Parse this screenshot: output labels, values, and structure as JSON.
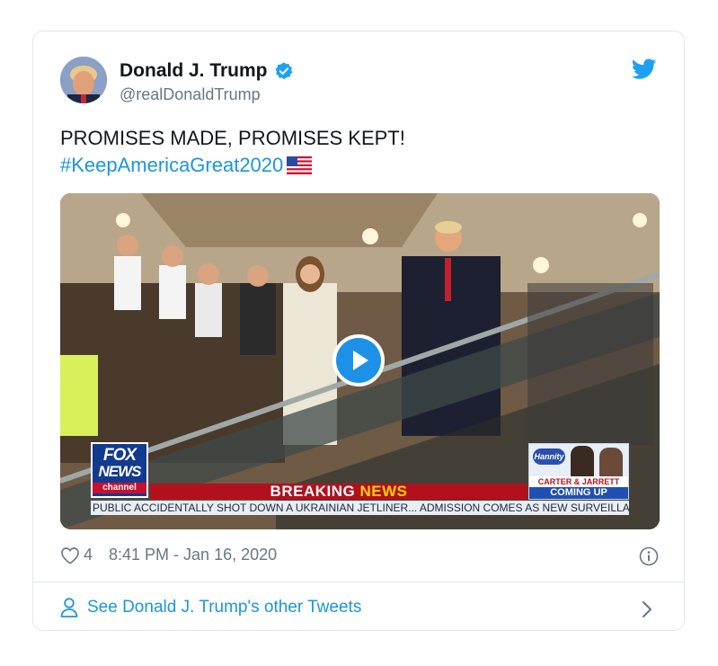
{
  "tweet": {
    "author_name": "Donald J. Trump",
    "author_handle": "@realDonaldTrump",
    "text": "PROMISES MADE, PROMISES KEPT!",
    "hashtag": "#KeepAmericaGreat2020",
    "flag_icon": "us-flag-icon",
    "likes": "4",
    "timestamp": "8:41 PM - Jan 16, 2020",
    "see_more_label": "See Donald J. Trump's other Tweets"
  },
  "video": {
    "channel_line1": "FOX",
    "channel_line2": "NEWS",
    "channel_line3": "channel",
    "banner_part1": "BREAKING ",
    "banner_part2": "NEWS",
    "promo_show": "Hannity",
    "promo_names": "CARTER & JARRETT",
    "promo_coming": "COMING UP",
    "ticker": "PUBLIC ACCIDENTALLY SHOT DOWN A UKRAINIAN JETLINER...   ADMISSION COMES AS NEW SURVEILLANC"
  },
  "colors": {
    "link_blue": "#1b95e0",
    "text_dark": "#14171a",
    "text_gray": "#657786",
    "play_blue": "#1d91e8",
    "breaking_red": "#b3101e"
  },
  "icons": [
    "verified-badge-icon",
    "twitter-bird-icon",
    "play-icon",
    "heart-icon",
    "info-icon",
    "person-icon",
    "chevron-right-icon"
  ]
}
